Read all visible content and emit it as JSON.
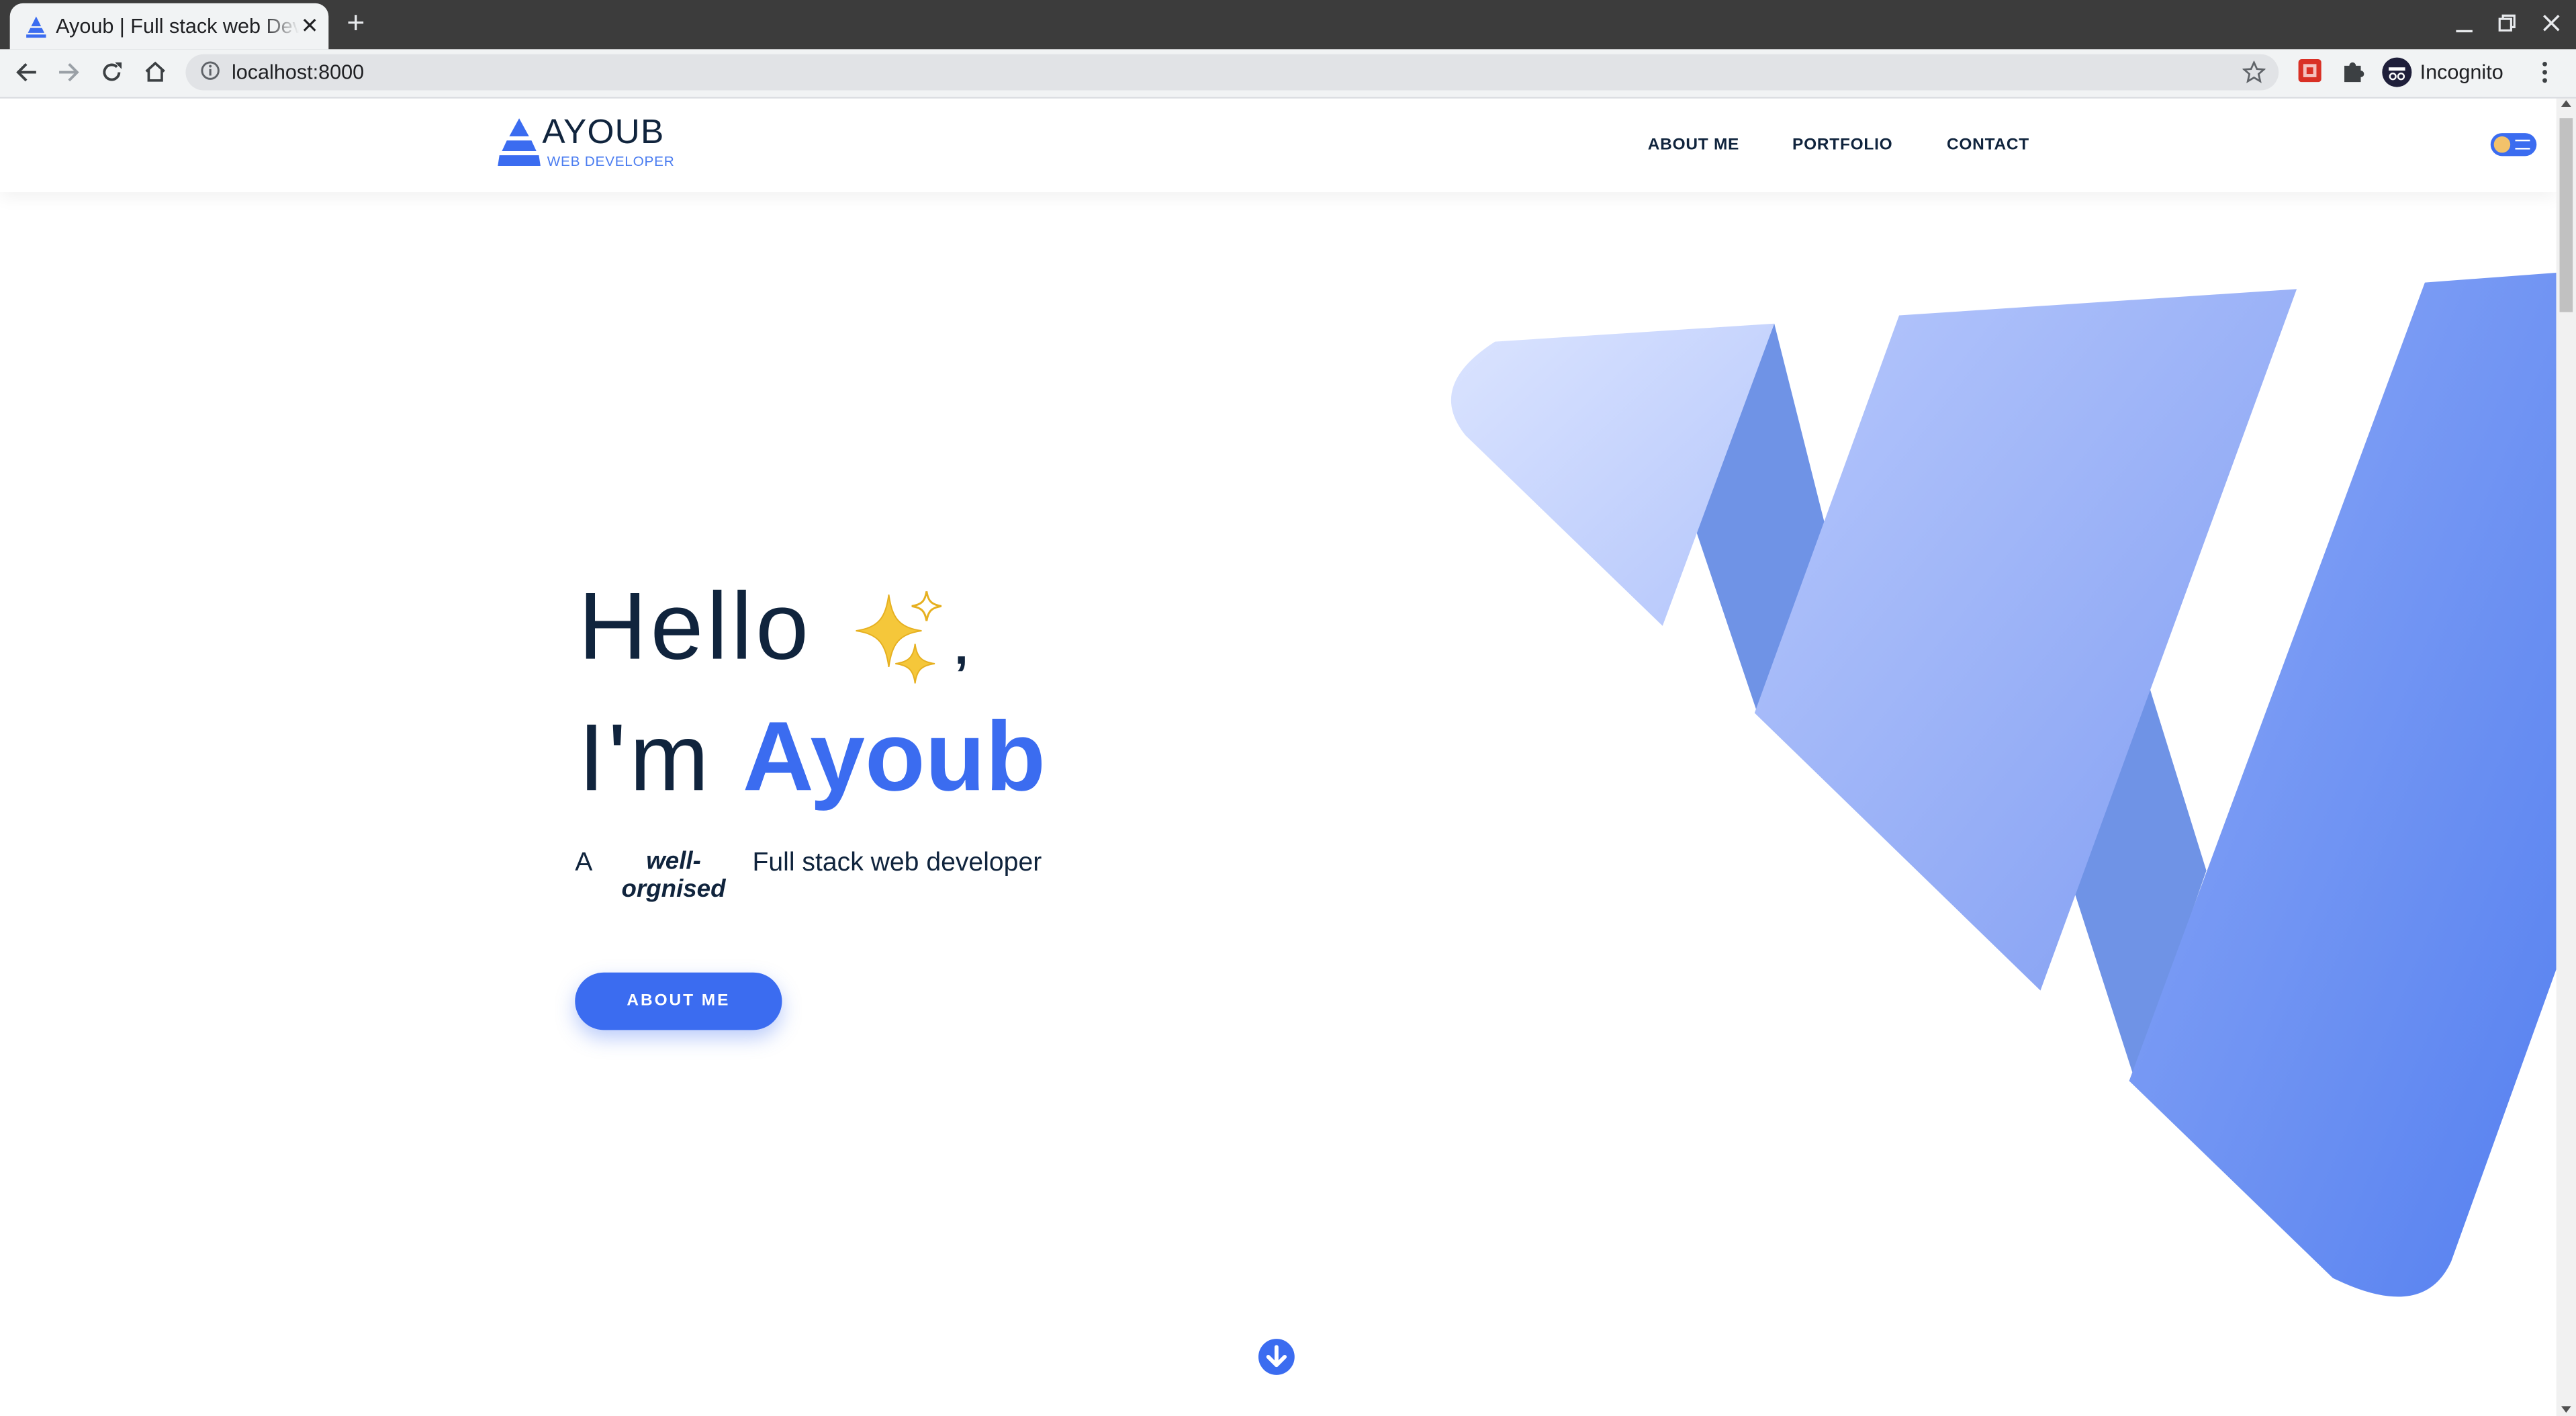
{
  "browser": {
    "tab_title": "Ayoub | Full stack web Developer",
    "tab_close": "✕",
    "new_tab": "+",
    "url": "localhost:8000",
    "profile_label": "Incognito",
    "window_controls": [
      "minimize-icon",
      "restore-icon",
      "close-icon"
    ]
  },
  "header": {
    "logo_name": "AYOUB",
    "logo_sub": "WEB DEVELOPER",
    "nav": [
      "ABOUT ME",
      "PORTFOLIO",
      "CONTACT"
    ]
  },
  "hero": {
    "hello": "Hello",
    "comma": ",",
    "im": "I'm",
    "name": "Ayoub",
    "tag_a": "A",
    "tag_b": "well-orgnised",
    "tag_c": "Full stack web developer",
    "cta": "ABOUT ME"
  },
  "colors": {
    "accent": "#3b6cf0",
    "heading": "#10243d",
    "chrome_dark": "#3c3c3c",
    "chrome_light": "#f1f3f4"
  }
}
